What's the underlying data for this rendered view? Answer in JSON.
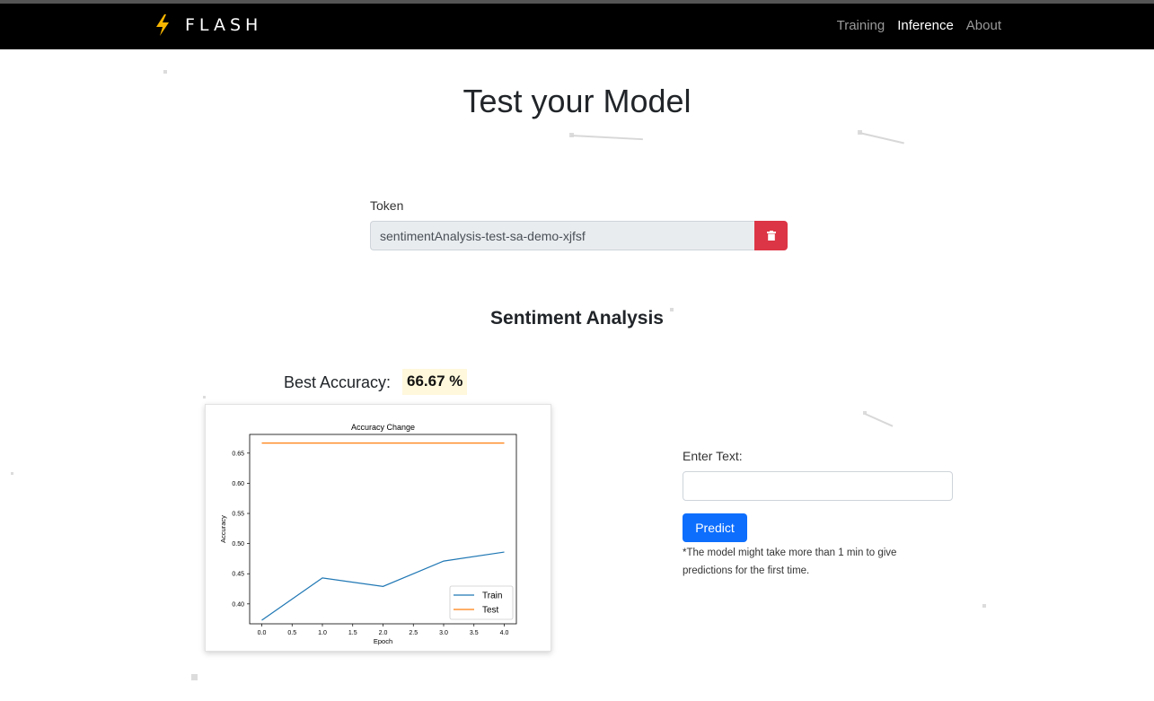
{
  "brand": {
    "name": "FLASH"
  },
  "nav": {
    "training": "Training",
    "inference": "Inference",
    "about": "About"
  },
  "page": {
    "title": "Test your Model"
  },
  "token": {
    "label": "Token",
    "value": "sentimentAnalysis-test-sa-demo-xjfsf"
  },
  "task": {
    "title": "Sentiment Analysis"
  },
  "accuracy": {
    "label": "Best Accuracy:",
    "value": "66.67 %"
  },
  "input": {
    "label": "Enter Text:",
    "value": "",
    "placeholder": ""
  },
  "predict": {
    "label": "Predict"
  },
  "note": "*The model might take more than 1 min to give predictions for the first time.",
  "colors": {
    "train": "#1f77b4",
    "test": "#ff7f0e",
    "delete": "#dc3545",
    "predict": "#0d6efd"
  },
  "chart_data": {
    "type": "line",
    "title": "Accuracy Change",
    "xlabel": "Epoch",
    "ylabel": "Accuracy",
    "x": [
      0,
      1,
      2,
      3,
      4
    ],
    "xticks": [
      "0.0",
      "0.5",
      "1.0",
      "1.5",
      "2.0",
      "2.5",
      "3.0",
      "3.5",
      "4.0"
    ],
    "yticks": [
      "0.40",
      "0.45",
      "0.50",
      "0.55",
      "0.60",
      "0.65"
    ],
    "xlim": [
      -0.2,
      4.2
    ],
    "ylim": [
      0.367,
      0.681
    ],
    "series": [
      {
        "name": "Train",
        "values": [
          0.373,
          0.443,
          0.429,
          0.471,
          0.486
        ]
      },
      {
        "name": "Test",
        "values": [
          0.6667,
          0.6667,
          0.6667,
          0.6667,
          0.6667
        ]
      }
    ],
    "legend": "lower-right",
    "grid": false
  }
}
